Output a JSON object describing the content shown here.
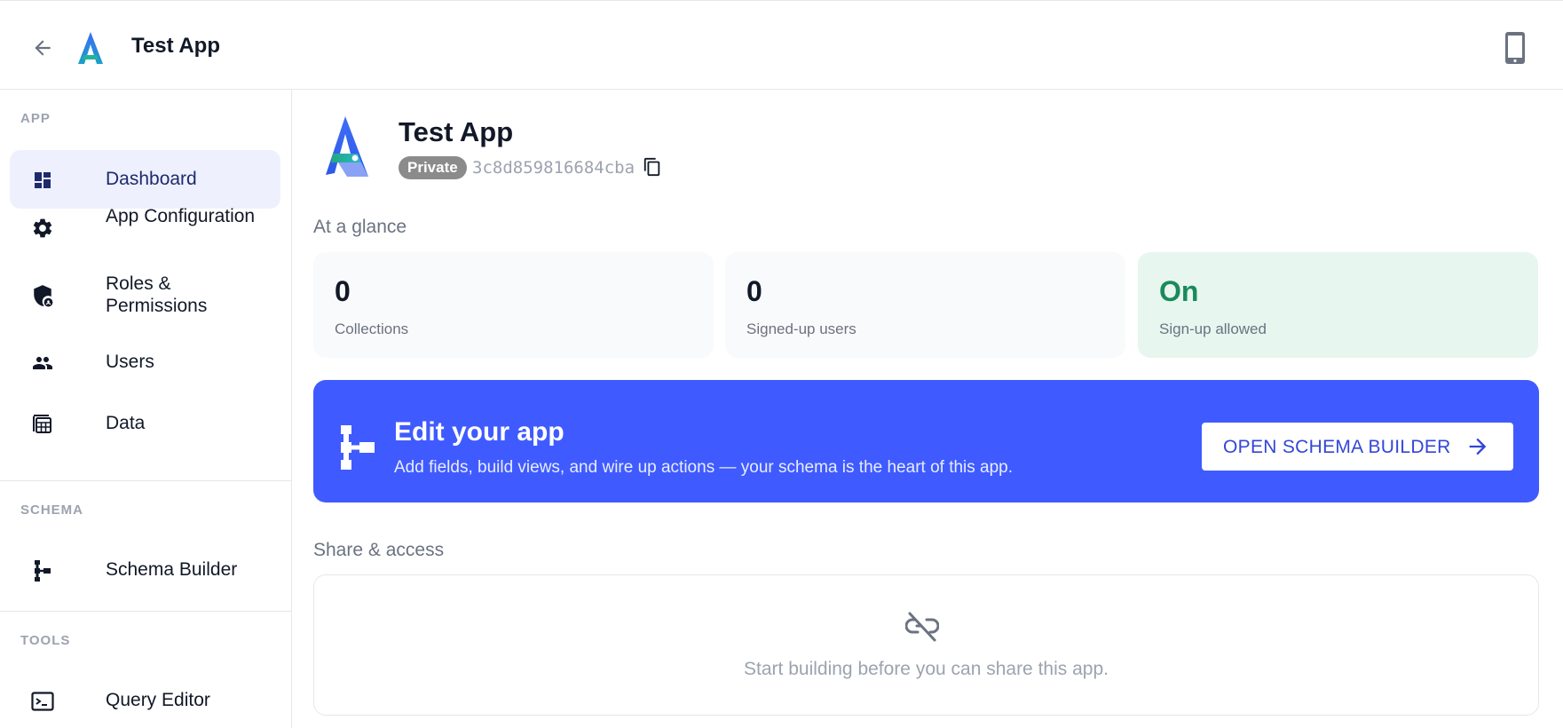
{
  "header": {
    "title": "Test App",
    "back_icon": "arrow-left-icon",
    "logo_icon": "app-logo-icon",
    "device_icon": "mobile-phone-icon"
  },
  "sidebar": {
    "sections": [
      {
        "label": "APP",
        "items": [
          {
            "label": "Dashboard",
            "icon": "dashboard-icon",
            "active": true
          },
          {
            "label": "App Configuration",
            "icon": "gear-icon",
            "active": false
          },
          {
            "label": "Roles & Permissions",
            "icon": "shield-lock-icon",
            "active": false
          },
          {
            "label": "Users",
            "icon": "users-icon",
            "active": false
          },
          {
            "label": "Data",
            "icon": "table-icon",
            "active": false
          }
        ]
      },
      {
        "label": "SCHEMA",
        "items": [
          {
            "label": "Schema Builder",
            "icon": "schema-tree-icon",
            "active": false
          }
        ]
      },
      {
        "label": "TOOLS",
        "items": [
          {
            "label": "Query Editor",
            "icon": "terminal-icon",
            "active": false
          }
        ]
      }
    ]
  },
  "main": {
    "app_name": "Test App",
    "visibility_badge": "Private",
    "app_id": "3c8d859816684cba",
    "glance_title": "At a glance",
    "stats": [
      {
        "value": "0",
        "label": "Collections"
      },
      {
        "value": "0",
        "label": "Signed-up users"
      },
      {
        "value": "On",
        "label": "Sign-up allowed"
      }
    ],
    "banner": {
      "title": "Edit your app",
      "description": "Add fields, build views, and wire up actions — your schema is the heart of this app.",
      "button_label": "OPEN SCHEMA BUILDER"
    },
    "share": {
      "title": "Share & access",
      "empty_message": "Start building before you can share this app."
    }
  },
  "colors": {
    "accent": "#3f5bff",
    "active_nav_bg": "#eef1fd",
    "on_status": "#1a8a5c",
    "on_card_bg": "#e7f6ef"
  }
}
